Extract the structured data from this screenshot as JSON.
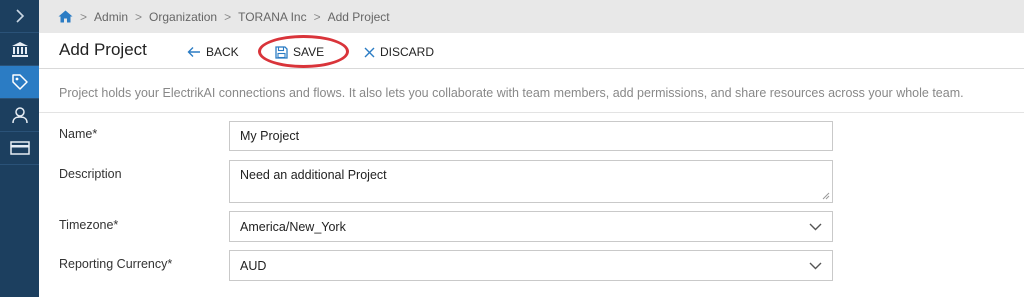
{
  "breadcrumb": {
    "home_icon": "home-icon",
    "items": [
      "Admin",
      "Organization",
      "TORANA Inc",
      "Add Project"
    ]
  },
  "sidebar": {
    "items": [
      {
        "icon": "chevron-right-icon",
        "active": false
      },
      {
        "icon": "bank-icon",
        "active": false
      },
      {
        "icon": "tag-icon",
        "active": true
      },
      {
        "icon": "user-icon",
        "active": false
      },
      {
        "icon": "card-icon",
        "active": false
      }
    ]
  },
  "toolbar": {
    "title": "Add Project",
    "back_label": "BACK",
    "save_label": "SAVE",
    "discard_label": "DISCARD"
  },
  "description": "Project holds your ElectrikAI connections and flows. It also lets you collaborate with team members, add permissions, and share resources across your whole team.",
  "form": {
    "name": {
      "label": "Name*",
      "value": "My Project"
    },
    "description": {
      "label": "Description",
      "value": "Need an additional Project"
    },
    "timezone": {
      "label": "Timezone*",
      "value": "America/New_York"
    },
    "currency": {
      "label": "Reporting Currency*",
      "value": "AUD"
    }
  },
  "colors": {
    "sidebar": "#1c3f5f",
    "sidebar_active": "#2b7cc4",
    "accent": "#2b7cc4",
    "highlight_circle": "#d9343a"
  }
}
